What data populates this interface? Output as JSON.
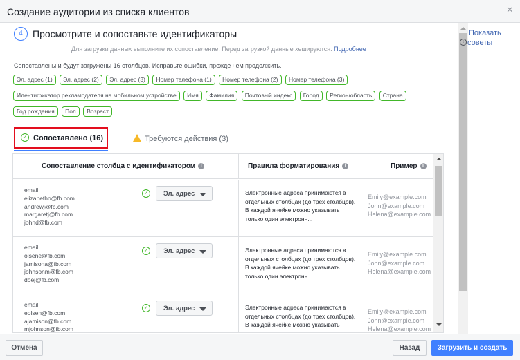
{
  "dialog": {
    "title": "Создание аудитории из списка клиентов",
    "close_glyph": "×"
  },
  "step": {
    "number": "4",
    "title": "Просмотрите и сопоставьте идентификаторы",
    "subtitle": "Для загрузки данных выполните их сопоставление. Перед загрузкой данные хешируются.",
    "more_link": "Подробнее"
  },
  "tips": {
    "line1": "Показать",
    "line2": "советы"
  },
  "matched_note": "Сопоставлены и будут загружены 16 столбцов. Исправьте ошибки, прежде чем продолжить.",
  "chips": [
    "Эл. адрес (1)",
    "Эл. адрес (2)",
    "Эл. адрес (3)",
    "Номер телефона (1)",
    "Номер телефона (2)",
    "Номер телефона (3)",
    "Идентификатор рекламодателя на мобильном устройстве",
    "Имя",
    "Фамилия",
    "Почтовый индекс",
    "Город",
    "Регион/область",
    "Страна",
    "Год рождения",
    "Пол",
    "Возраст"
  ],
  "tabs": {
    "matched": "Сопоставлено (16)",
    "action": "Требуются действия (3)"
  },
  "table": {
    "headers": {
      "mapping": "Сопоставление столбца с идентификатором",
      "rules": "Правила форматирования",
      "example": "Пример"
    },
    "rows": [
      {
        "values": [
          "email",
          "elizabetho@fb.com",
          "andrewj@fb.com",
          "margaretj@fb.com",
          "johnd@fb.com"
        ],
        "identifier": "Эл. адрес",
        "rule": "Электронные адреса принимаются в отдельных столбцах (до трех столбцов). В каждой ячейке можно указывать только один электронн...",
        "examples": [
          "Emily@example.com",
          "John@example.com",
          "Helena@example.com"
        ]
      },
      {
        "values": [
          "email",
          "olsene@fb.com",
          "jamisona@fb.com",
          "johnsonm@fb.com",
          "doej@fb.com"
        ],
        "identifier": "Эл. адрес",
        "rule": "Электронные адреса принимаются в отдельных столбцах (до трех столбцов). В каждой ячейке можно указывать только один электронн...",
        "examples": [
          "Emily@example.com",
          "John@example.com",
          "Helena@example.com"
        ]
      },
      {
        "values": [
          "email",
          "eolsen@fb.com",
          "ajamison@fb.com",
          "mjohnson@fb.com"
        ],
        "identifier": "Эл. адрес",
        "rule": "Электронные адреса принимаются в отдельных столбцах (до трех столбцов). В каждой ячейке можно указывать только один электронн...",
        "examples": [
          "Emily@example.com",
          "John@example.com",
          "Helena@example.com"
        ]
      }
    ]
  },
  "footer": {
    "cancel": "Отмена",
    "back": "Назад",
    "upload": "Загрузить и создать"
  },
  "colors": {
    "accent": "#4080ff",
    "link": "#4267b2",
    "chip_border": "#42b72a",
    "highlight_box": "#e30e1e",
    "warning": "#f7b928"
  }
}
